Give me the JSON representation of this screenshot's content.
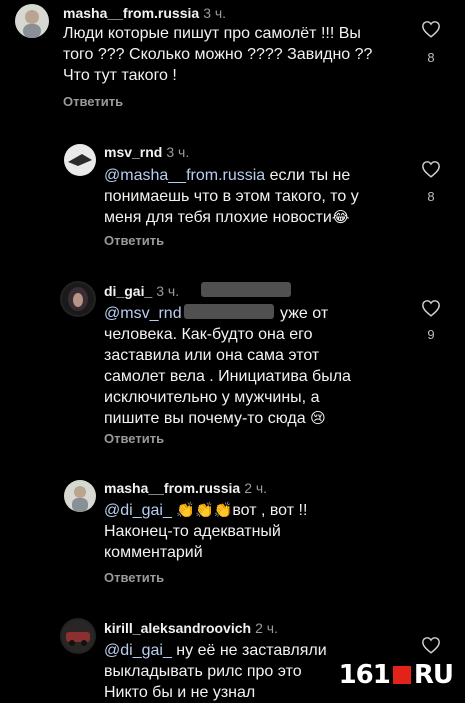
{
  "ui": {
    "reply_label": "Ответить"
  },
  "comments": [
    {
      "username": "masha__from.russia",
      "time": "3 ч.",
      "lines": [
        "Люди которые пишут про самолёт !!! Вы",
        "того ??? Сколько можно ???? Завидно ??",
        "Что тут такого !"
      ],
      "likes": "8"
    },
    {
      "username": "msv_rnd",
      "time": "3 ч.",
      "mention": "@masha__from.russia",
      "lines": [
        " если ты не",
        "понимаешь что в этом такого, то у",
        "меня для тебя плохие новости"
      ],
      "emoji": "😂",
      "likes": "8"
    },
    {
      "username": "di_gai_",
      "time": "3 ч.",
      "mention": "@msv_rnd",
      "lines": [
        " уже от",
        "человека. Как-будто она его",
        "заставила или она сама этот",
        "самолет вела . Инициатива была",
        "исключительно у мужчины, а",
        "пишите вы почему-то сюда "
      ],
      "emoji": "😢",
      "likes": "9"
    },
    {
      "username": "masha__from.russia",
      "time": "2 ч.",
      "mention": "@di_gai_",
      "emoji": "👏👏👏",
      "lines": [
        "вот , вот !!",
        "Наконец-то адекватный",
        "комментарий"
      ]
    },
    {
      "username": "kirill_aleksandroovich",
      "time": "2 ч.",
      "mention": "@di_gai_",
      "lines": [
        " ну её не заставляли",
        "выкладывать рилс про это",
        "Никто бы и не узнал"
      ]
    }
  ],
  "icons": {
    "heart": "heart-icon",
    "emoji_laugh": "😂",
    "emoji_sad": "😢",
    "emoji_clap": "👏"
  },
  "colors": {
    "background": "#000000",
    "text": "#f2f2f2",
    "muted": "#9a9a9a",
    "mention": "#b9cdf0",
    "watermark_red": "#e2231a"
  },
  "watermark": {
    "prefix": "161",
    "suffix": "RU"
  }
}
